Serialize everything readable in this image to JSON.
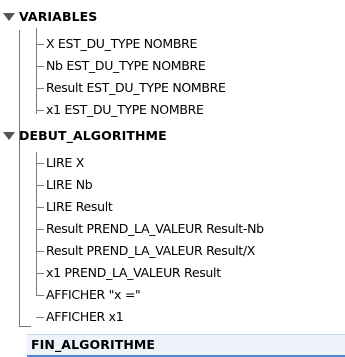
{
  "tree": {
    "variables": {
      "label": "VARIABLES",
      "items": [
        "X EST_DU_TYPE NOMBRE",
        "Nb EST_DU_TYPE NOMBRE",
        "Result EST_DU_TYPE NOMBRE",
        "x1 EST_DU_TYPE NOMBRE"
      ]
    },
    "debut": {
      "label": "DEBUT_ALGORITHME",
      "items": [
        "LIRE X",
        "LIRE Nb",
        "LIRE Result",
        "Result PREND_LA_VALEUR Result-Nb",
        "Result PREND_LA_VALEUR Result/X",
        "x1 PREND_LA_VALEUR Result",
        "AFFICHER \"x =\"",
        "AFFICHER x1"
      ]
    },
    "fin": {
      "label": "FIN_ALGORITHME",
      "selected": true
    }
  },
  "colors": {
    "tree_lines": "#7a7a7a",
    "selection_background": "#eef3fb",
    "selection_border": "#4f86d6",
    "toggle_arrow": "#555555"
  },
  "icons": {
    "expanded_toggle": "triangle-down-icon"
  }
}
